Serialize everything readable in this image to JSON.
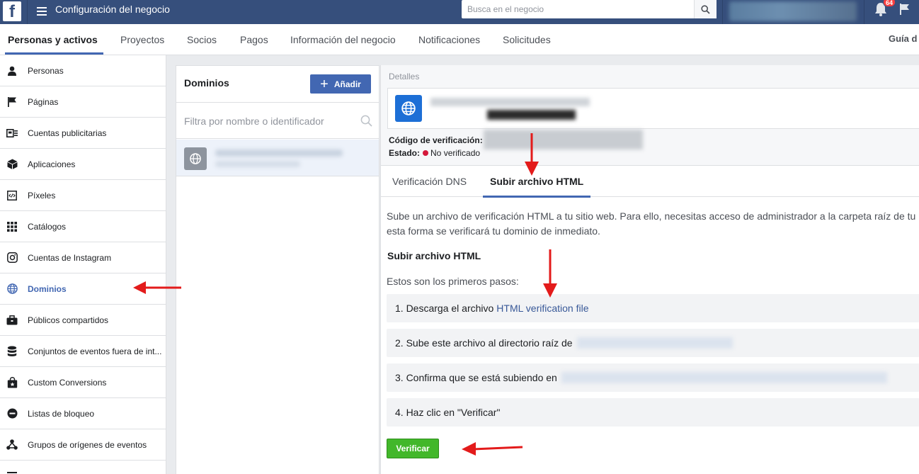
{
  "topbar": {
    "logo_letter": "f",
    "title": "Configuración del negocio",
    "search_placeholder": "Busca en el negocio",
    "notification_count": "64"
  },
  "tabs": [
    {
      "label": "Personas y activos",
      "active": true
    },
    {
      "label": "Proyectos"
    },
    {
      "label": "Socios"
    },
    {
      "label": "Pagos"
    },
    {
      "label": "Información del negocio"
    },
    {
      "label": "Notificaciones"
    },
    {
      "label": "Solicitudes"
    }
  ],
  "guide_label": "Guía d",
  "sidebar": {
    "items": [
      {
        "label": "Personas",
        "icon": "person-icon"
      },
      {
        "label": "Páginas",
        "icon": "flag-icon"
      },
      {
        "label": "Cuentas publicitarias",
        "icon": "ad-account-icon"
      },
      {
        "label": "Aplicaciones",
        "icon": "cube-icon"
      },
      {
        "label": "Píxeles",
        "icon": "code-icon"
      },
      {
        "label": "Catálogos",
        "icon": "grid-icon"
      },
      {
        "label": "Cuentas de Instagram",
        "icon": "instagram-icon"
      },
      {
        "label": "Dominios",
        "icon": "globe-icon",
        "active": true
      },
      {
        "label": "Públicos compartidos",
        "icon": "briefcase-icon"
      },
      {
        "label": "Conjuntos de eventos fuera de int...",
        "icon": "database-icon"
      },
      {
        "label": "Custom Conversions",
        "icon": "shopping-bag-icon"
      },
      {
        "label": "Listas de bloqueo",
        "icon": "minus-circle-icon"
      },
      {
        "label": "Grupos de orígenes de eventos",
        "icon": "network-icon"
      },
      {
        "label": "",
        "icon": "list-icon"
      }
    ]
  },
  "domains": {
    "title": "Dominios",
    "add_label": "Añadir",
    "filter_placeholder": "Filtra por nombre o identificador"
  },
  "details": {
    "section_label": "Detalles",
    "verification_code_label": "Código de verificación:",
    "state_label": "Estado:",
    "state_value": "No verificado",
    "tabs": [
      {
        "label": "Verificación DNS"
      },
      {
        "label": "Subir archivo HTML",
        "active": true
      }
    ],
    "description_line1": "Sube un archivo de verificación HTML a tu sitio web. Para ello, necesitas acceso de administrador a la carpeta raíz de tu",
    "description_line2": "esta forma se verificará tu dominio de inmediato.",
    "section_title": "Subir archivo HTML",
    "steps_intro": "Estos son los primeros pasos:",
    "steps": [
      {
        "text": "1. Descarga el archivo",
        "link": "HTML verification file"
      },
      {
        "text": "2. Sube este archivo al directorio raíz de"
      },
      {
        "text": "3. Confirma que se está subiendo en"
      },
      {
        "text": "4. Haz clic en \"Verificar\""
      }
    ],
    "verify_label": "Verificar"
  },
  "colors": {
    "topbar": "#364f7c",
    "accent": "#4267b2",
    "verify_green": "#42b72a",
    "annotation_red": "#e31b1b"
  }
}
